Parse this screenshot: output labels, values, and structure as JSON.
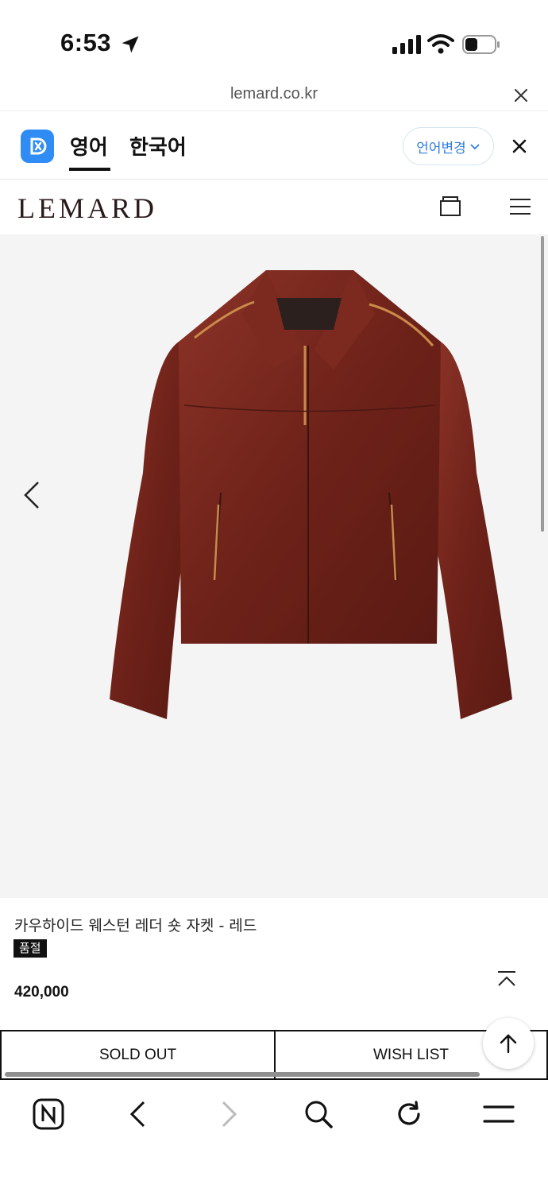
{
  "status_bar": {
    "time": "6:53"
  },
  "browser": {
    "url": "lemard.co.kr"
  },
  "translate_bar": {
    "tab_source": "영어",
    "tab_target": "한국어",
    "change_language": "언어변경",
    "accent_color": "#2f8cf5"
  },
  "site": {
    "brand": "LEMARD"
  },
  "product": {
    "name": "카우하이드 웨스턴 레더 숏 자켓 - 레드",
    "badge": "품절",
    "price": "420,000",
    "image_alt_color": "#7a2a22"
  },
  "actions": {
    "sold_out": "SOLD OUT",
    "wish_list": "WISH LIST"
  },
  "icons": [
    "location-arrow-icon",
    "signal-icon",
    "wifi-icon",
    "battery-icon",
    "close-icon",
    "translate-logo-icon",
    "chevron-down-icon",
    "shopping-bag-icon",
    "hamburger-menu-icon",
    "chevron-left-icon",
    "collapse-up-icon",
    "arrow-up-icon",
    "naver-home-icon",
    "back-icon",
    "forward-icon",
    "search-icon",
    "refresh-icon",
    "menu-icon"
  ]
}
